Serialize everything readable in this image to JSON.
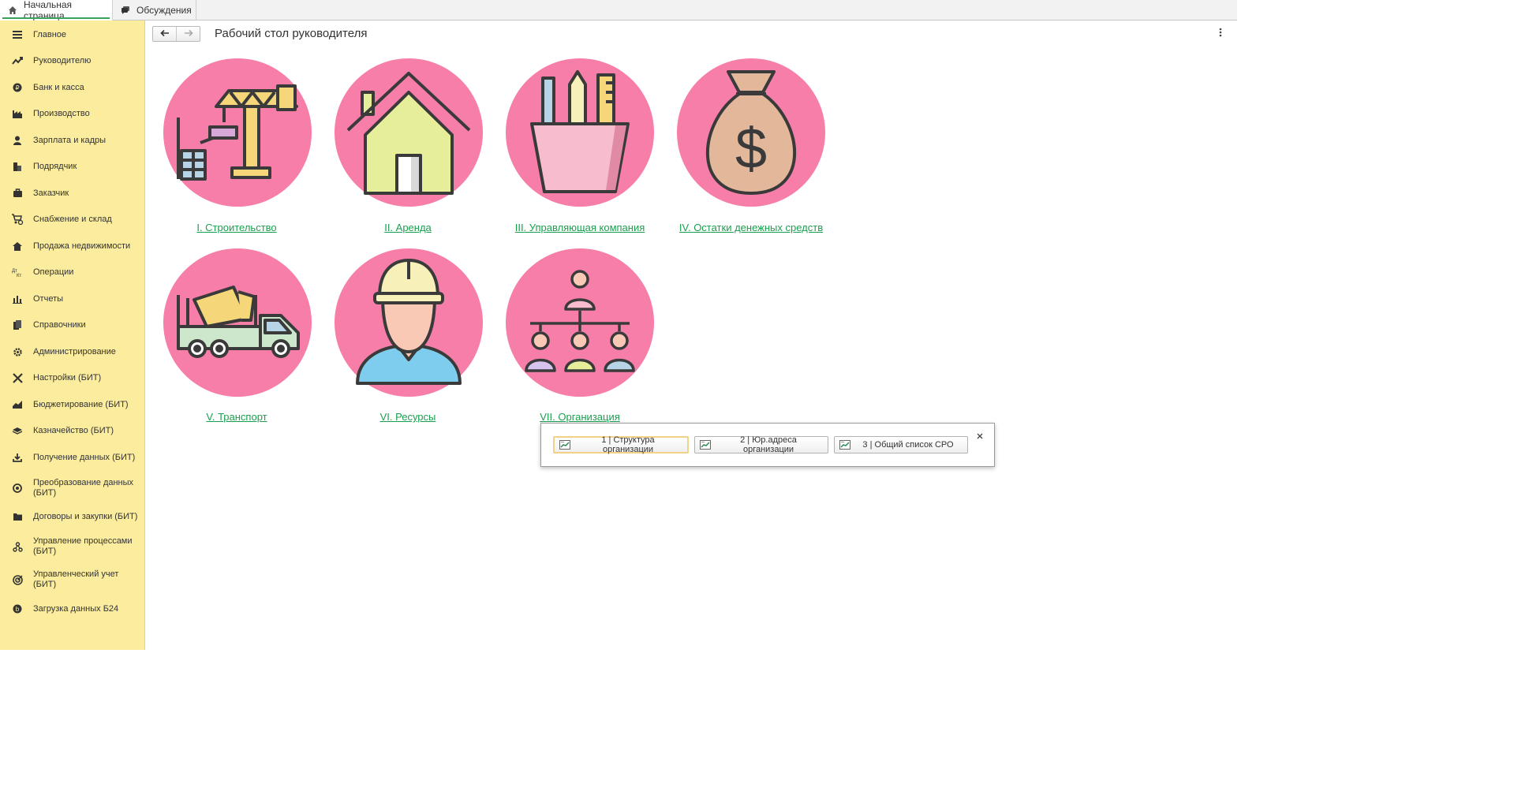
{
  "top_tabs": [
    {
      "label": "Начальная страница",
      "icon": "home-icon"
    },
    {
      "label": "Обсуждения",
      "icon": "discussions-icon"
    }
  ],
  "sidebar": {
    "background": "#fbec9e",
    "items": [
      {
        "label": "Главное",
        "icon": "menu-icon"
      },
      {
        "label": "Руководителю",
        "icon": "trend-icon"
      },
      {
        "label": "Банк и касса",
        "icon": "coin-icon"
      },
      {
        "label": "Производство",
        "icon": "factory-icon"
      },
      {
        "label": "Зарплата и кадры",
        "icon": "person-icon"
      },
      {
        "label": "Подрядчик",
        "icon": "building-icon"
      },
      {
        "label": "Заказчик",
        "icon": "briefcase-icon"
      },
      {
        "label": "Снабжение и склад",
        "icon": "cart-icon"
      },
      {
        "label": "Продажа недвижимости",
        "icon": "house-icon"
      },
      {
        "label": "Операции",
        "icon": "dt-kt-icon"
      },
      {
        "label": "Отчеты",
        "icon": "bar-chart-icon"
      },
      {
        "label": "Справочники",
        "icon": "books-icon"
      },
      {
        "label": "Администрирование",
        "icon": "gear-icon"
      },
      {
        "label": "Настройки (БИТ)",
        "icon": "tools-icon"
      },
      {
        "label": "Бюджетирование (БИТ)",
        "icon": "area-chart-icon"
      },
      {
        "label": "Казначейство (БИТ)",
        "icon": "money-stack-icon"
      },
      {
        "label": "Получение данных (БИТ)",
        "icon": "download-icon"
      },
      {
        "label": "Преобразование данных (БИТ)",
        "icon": "transform-icon"
      },
      {
        "label": "Договоры и закупки (БИТ)",
        "icon": "folder-icon"
      },
      {
        "label": "Управление процессами (БИТ)",
        "icon": "process-icon"
      },
      {
        "label": "Управленческий учет (БИТ)",
        "icon": "target-icon"
      },
      {
        "label": "Загрузка данных Б24",
        "icon": "b24-icon"
      }
    ]
  },
  "header": {
    "title": "Рабочий стол руководителя",
    "back_icon": "arrow-left-icon",
    "forward_icon": "arrow-right-icon",
    "more_icon": "more-vertical-icon"
  },
  "tiles": [
    {
      "label": "I. Строительство",
      "icon": "crane-icon"
    },
    {
      "label": "II. Аренда",
      "icon": "house-icon"
    },
    {
      "label": "III. Управляющая компания",
      "icon": "pencil-cup-icon"
    },
    {
      "label": "IV. Остатки денежных средств",
      "icon": "money-bag-icon"
    },
    {
      "label": "V. Транспорт",
      "icon": "concrete-truck-icon"
    },
    {
      "label": "VI. Ресурсы",
      "icon": "worker-icon"
    },
    {
      "label": "VII. Организация",
      "icon": "org-chart-icon"
    }
  ],
  "popup": {
    "buttons": [
      {
        "label": "1 | Структура организации",
        "icon": "report-icon"
      },
      {
        "label": "2 | Юр.адреса организации",
        "icon": "report-icon"
      },
      {
        "label": "3 | Общий список СРО",
        "icon": "report-icon"
      }
    ],
    "close_icon": "close-icon"
  },
  "colors": {
    "link": "#1a9f4f",
    "tile_circle": "#f77ea8",
    "accent": "#3aa35a"
  }
}
